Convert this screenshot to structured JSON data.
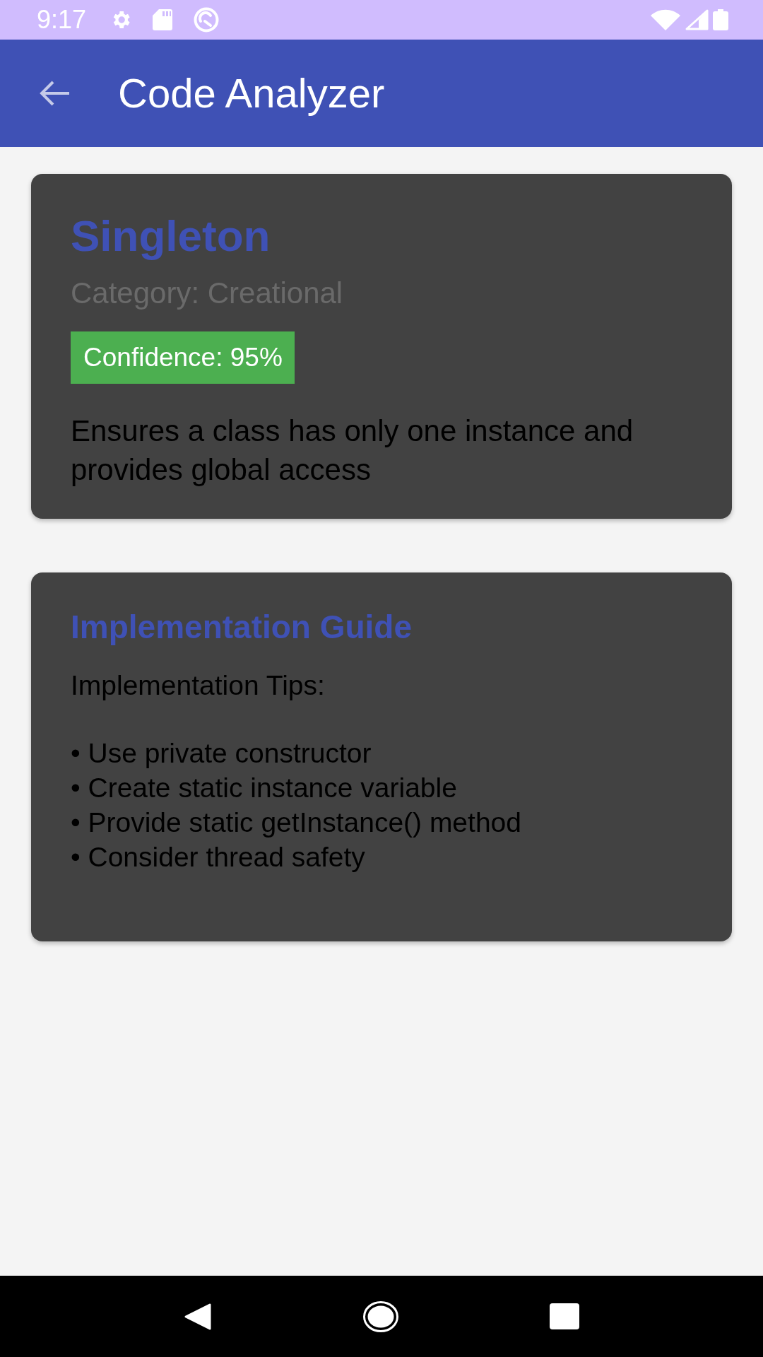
{
  "status_bar": {
    "time": "9:17"
  },
  "app_bar": {
    "title": "Code Analyzer"
  },
  "pattern_card": {
    "name": "Singleton",
    "category": "Category: Creational",
    "confidence": "Confidence: 95%",
    "description": "Ensures a class has only one instance and provides global access"
  },
  "guide_card": {
    "title": "Implementation Guide",
    "heading": "Implementation Tips:",
    "tips": [
      "• Use private constructor",
      "• Create static instance variable",
      "• Provide static getInstance() method",
      "• Consider thread safety"
    ]
  }
}
